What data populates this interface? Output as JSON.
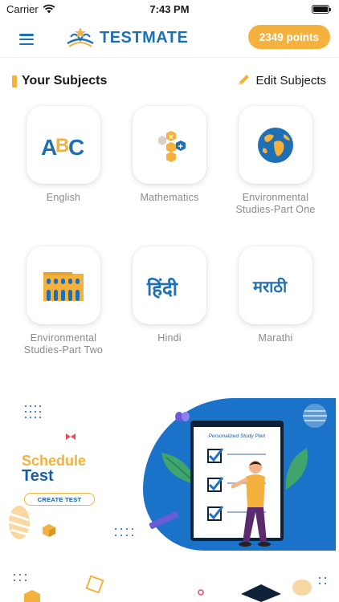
{
  "status_bar": {
    "carrier": "Carrier",
    "time": "7:43 PM",
    "battery_level": 1.0
  },
  "header": {
    "app_name": "TESTMATE",
    "points_label": "2349 points",
    "colors": {
      "brand": "#1f6fb5",
      "accent": "#f4b13d"
    }
  },
  "subjects_section": {
    "title": "Your Subjects",
    "edit_label": "Edit Subjects",
    "subjects": [
      {
        "name": "English",
        "icon": "abc-letters-icon"
      },
      {
        "name": "Mathematics",
        "icon": "math-hexagons-icon"
      },
      {
        "name": "Environmental Studies-Part One",
        "icon": "globe-icon"
      },
      {
        "name": "Environmental Studies-Part Two",
        "icon": "colosseum-icon"
      },
      {
        "name": "Hindi",
        "icon": "hindi-script-icon"
      },
      {
        "name": "Marathi",
        "icon": "marathi-script-icon"
      }
    ]
  },
  "banner": {
    "title_line1": "Schedule",
    "title_line2": "Test",
    "button_label": "CREATE TEST",
    "board_title": "Personalized Study Plan"
  },
  "icon_glyphs": {
    "abc_a": "A",
    "abc_b": "B",
    "abc_c": "C",
    "hindi": "हिंदी",
    "marathi": "मराठी",
    "math_x": "×",
    "math_plus": "+"
  }
}
